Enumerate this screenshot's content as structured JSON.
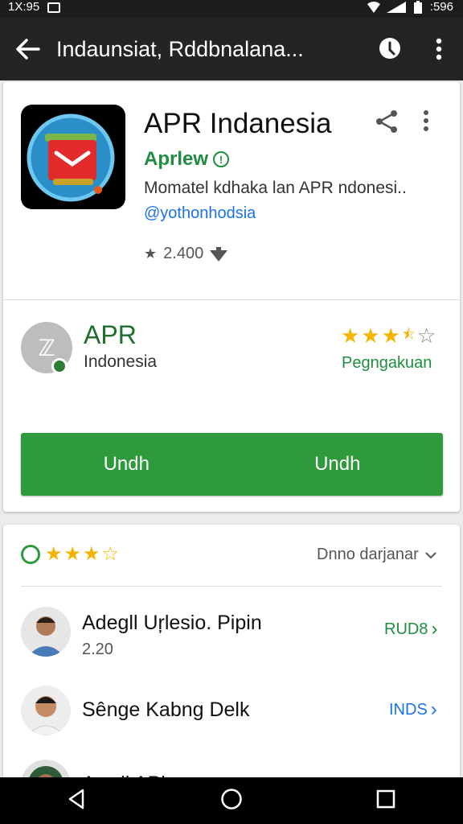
{
  "status_bar": {
    "time": "1X:95",
    "right_text": ":596"
  },
  "app_bar": {
    "title": "Indaunsiat, Rddbnalana..."
  },
  "app": {
    "name": "APR Indanesia",
    "developer": "Aprlew",
    "description": "Momatel kdhaka lan APR ndonesi..",
    "handle": "@yothonhodsia",
    "downloads": "2.400"
  },
  "publisher": {
    "name": "APR",
    "subtitle": "Indonesia",
    "rating_label": "Pegngakuan",
    "rating": 3.5
  },
  "install": {
    "label_left": "Undh",
    "label_right": "Undh"
  },
  "reviews": {
    "sort_label": "Dnno darjanar",
    "rating": 3.5,
    "items": [
      {
        "name": "Adegll Uŗlesio. Pipin",
        "sub": "2.20",
        "link": "RUD8",
        "link_color": "#1e8e3e"
      },
      {
        "name": "Sênge Kabng Delk",
        "sub": "",
        "link": "INDS",
        "link_color": "#1a73e8"
      },
      {
        "name": "Awall APh..",
        "sub": "",
        "link": "",
        "link_color": "#1e8e3e"
      }
    ]
  },
  "colors": {
    "accent_green": "#2e9a3c",
    "star": "#f4b400",
    "link_blue": "#1a73e8"
  }
}
